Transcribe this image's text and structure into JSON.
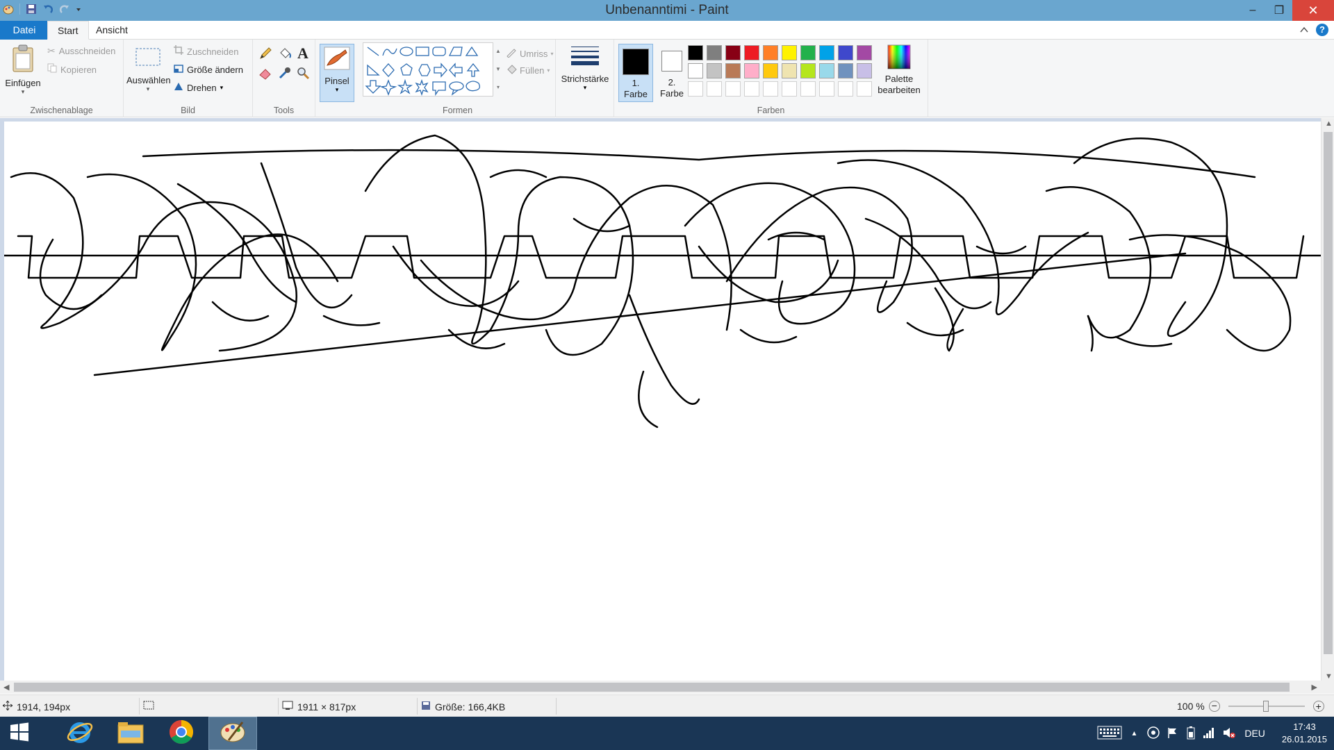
{
  "window": {
    "title": "Unbenanntimi - Paint",
    "minimize": "–",
    "restore": "❐",
    "close": "✕"
  },
  "tabs": {
    "file": "Datei",
    "start": "Start",
    "view": "Ansicht",
    "help": "?"
  },
  "ribbon": {
    "clipboard": {
      "label": "Zwischenablage",
      "paste": "Einfügen",
      "cut": "Ausschneiden",
      "copy": "Kopieren"
    },
    "image": {
      "label": "Bild",
      "select": "Auswählen",
      "crop": "Zuschneiden",
      "resize": "Größe ändern",
      "rotate": "Drehen"
    },
    "tools": {
      "label": "Tools"
    },
    "brush": {
      "label": "Pinsel"
    },
    "shapes": {
      "label": "Formen",
      "outline": "Umriss",
      "fill": "Füllen"
    },
    "size": {
      "label": "Strichstärke"
    },
    "colors": {
      "label": "Farben",
      "color1_num": "1.",
      "color1_word": "Farbe",
      "color2_num": "2.",
      "color2_word": "Farbe",
      "edit_1": "Palette",
      "edit_2": "bearbeiten",
      "color1": "#000000",
      "color2": "#ffffff",
      "palette_row1": [
        "#000000",
        "#7f7f7f",
        "#880015",
        "#ed1c24",
        "#ff7f27",
        "#fff200",
        "#22b14c",
        "#00a2e8",
        "#3f48cc",
        "#a349a4"
      ],
      "palette_row2": [
        "#ffffff",
        "#c3c3c3",
        "#b97a57",
        "#ffaec9",
        "#ffc90e",
        "#efe4b0",
        "#b5e61d",
        "#99d9ea",
        "#7092be",
        "#c8bfe7"
      ]
    }
  },
  "status": {
    "cursor_pos": "1914, 194px",
    "canvas_size": "1911 × 817px",
    "file_size": "Größe: 166,4KB",
    "zoom": "100 %"
  },
  "taskbar": {
    "lang": "DEU",
    "time": "17:43",
    "date": "26.01.2015"
  }
}
